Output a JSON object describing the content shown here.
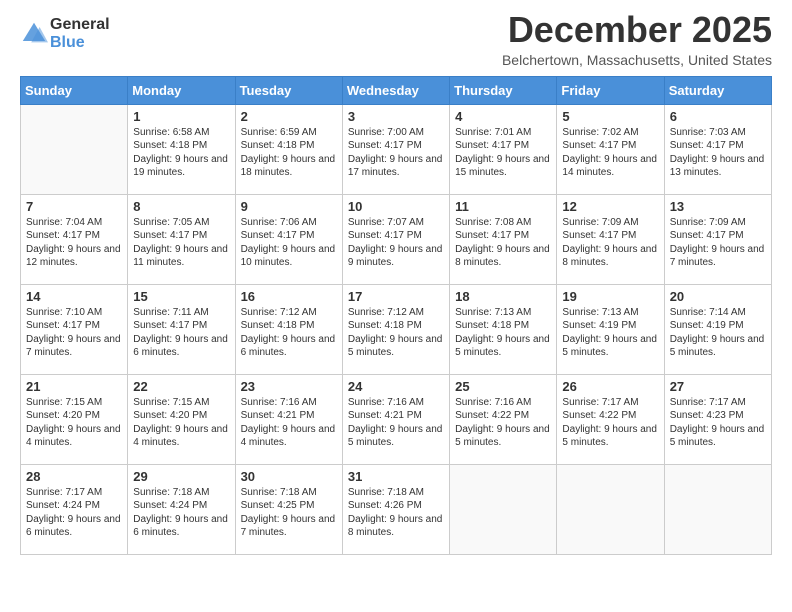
{
  "header": {
    "logo_line1": "General",
    "logo_line2": "Blue",
    "month_title": "December 2025",
    "location": "Belchertown, Massachusetts, United States"
  },
  "weekdays": [
    "Sunday",
    "Monday",
    "Tuesday",
    "Wednesday",
    "Thursday",
    "Friday",
    "Saturday"
  ],
  "weeks": [
    [
      {
        "day": "",
        "sunrise": "",
        "sunset": "",
        "daylight": ""
      },
      {
        "day": "1",
        "sunrise": "Sunrise: 6:58 AM",
        "sunset": "Sunset: 4:18 PM",
        "daylight": "Daylight: 9 hours and 19 minutes."
      },
      {
        "day": "2",
        "sunrise": "Sunrise: 6:59 AM",
        "sunset": "Sunset: 4:18 PM",
        "daylight": "Daylight: 9 hours and 18 minutes."
      },
      {
        "day": "3",
        "sunrise": "Sunrise: 7:00 AM",
        "sunset": "Sunset: 4:17 PM",
        "daylight": "Daylight: 9 hours and 17 minutes."
      },
      {
        "day": "4",
        "sunrise": "Sunrise: 7:01 AM",
        "sunset": "Sunset: 4:17 PM",
        "daylight": "Daylight: 9 hours and 15 minutes."
      },
      {
        "day": "5",
        "sunrise": "Sunrise: 7:02 AM",
        "sunset": "Sunset: 4:17 PM",
        "daylight": "Daylight: 9 hours and 14 minutes."
      },
      {
        "day": "6",
        "sunrise": "Sunrise: 7:03 AM",
        "sunset": "Sunset: 4:17 PM",
        "daylight": "Daylight: 9 hours and 13 minutes."
      }
    ],
    [
      {
        "day": "7",
        "sunrise": "Sunrise: 7:04 AM",
        "sunset": "Sunset: 4:17 PM",
        "daylight": "Daylight: 9 hours and 12 minutes."
      },
      {
        "day": "8",
        "sunrise": "Sunrise: 7:05 AM",
        "sunset": "Sunset: 4:17 PM",
        "daylight": "Daylight: 9 hours and 11 minutes."
      },
      {
        "day": "9",
        "sunrise": "Sunrise: 7:06 AM",
        "sunset": "Sunset: 4:17 PM",
        "daylight": "Daylight: 9 hours and 10 minutes."
      },
      {
        "day": "10",
        "sunrise": "Sunrise: 7:07 AM",
        "sunset": "Sunset: 4:17 PM",
        "daylight": "Daylight: 9 hours and 9 minutes."
      },
      {
        "day": "11",
        "sunrise": "Sunrise: 7:08 AM",
        "sunset": "Sunset: 4:17 PM",
        "daylight": "Daylight: 9 hours and 8 minutes."
      },
      {
        "day": "12",
        "sunrise": "Sunrise: 7:09 AM",
        "sunset": "Sunset: 4:17 PM",
        "daylight": "Daylight: 9 hours and 8 minutes."
      },
      {
        "day": "13",
        "sunrise": "Sunrise: 7:09 AM",
        "sunset": "Sunset: 4:17 PM",
        "daylight": "Daylight: 9 hours and 7 minutes."
      }
    ],
    [
      {
        "day": "14",
        "sunrise": "Sunrise: 7:10 AM",
        "sunset": "Sunset: 4:17 PM",
        "daylight": "Daylight: 9 hours and 7 minutes."
      },
      {
        "day": "15",
        "sunrise": "Sunrise: 7:11 AM",
        "sunset": "Sunset: 4:17 PM",
        "daylight": "Daylight: 9 hours and 6 minutes."
      },
      {
        "day": "16",
        "sunrise": "Sunrise: 7:12 AM",
        "sunset": "Sunset: 4:18 PM",
        "daylight": "Daylight: 9 hours and 6 minutes."
      },
      {
        "day": "17",
        "sunrise": "Sunrise: 7:12 AM",
        "sunset": "Sunset: 4:18 PM",
        "daylight": "Daylight: 9 hours and 5 minutes."
      },
      {
        "day": "18",
        "sunrise": "Sunrise: 7:13 AM",
        "sunset": "Sunset: 4:18 PM",
        "daylight": "Daylight: 9 hours and 5 minutes."
      },
      {
        "day": "19",
        "sunrise": "Sunrise: 7:13 AM",
        "sunset": "Sunset: 4:19 PM",
        "daylight": "Daylight: 9 hours and 5 minutes."
      },
      {
        "day": "20",
        "sunrise": "Sunrise: 7:14 AM",
        "sunset": "Sunset: 4:19 PM",
        "daylight": "Daylight: 9 hours and 5 minutes."
      }
    ],
    [
      {
        "day": "21",
        "sunrise": "Sunrise: 7:15 AM",
        "sunset": "Sunset: 4:20 PM",
        "daylight": "Daylight: 9 hours and 4 minutes."
      },
      {
        "day": "22",
        "sunrise": "Sunrise: 7:15 AM",
        "sunset": "Sunset: 4:20 PM",
        "daylight": "Daylight: 9 hours and 4 minutes."
      },
      {
        "day": "23",
        "sunrise": "Sunrise: 7:16 AM",
        "sunset": "Sunset: 4:21 PM",
        "daylight": "Daylight: 9 hours and 4 minutes."
      },
      {
        "day": "24",
        "sunrise": "Sunrise: 7:16 AM",
        "sunset": "Sunset: 4:21 PM",
        "daylight": "Daylight: 9 hours and 5 minutes."
      },
      {
        "day": "25",
        "sunrise": "Sunrise: 7:16 AM",
        "sunset": "Sunset: 4:22 PM",
        "daylight": "Daylight: 9 hours and 5 minutes."
      },
      {
        "day": "26",
        "sunrise": "Sunrise: 7:17 AM",
        "sunset": "Sunset: 4:22 PM",
        "daylight": "Daylight: 9 hours and 5 minutes."
      },
      {
        "day": "27",
        "sunrise": "Sunrise: 7:17 AM",
        "sunset": "Sunset: 4:23 PM",
        "daylight": "Daylight: 9 hours and 5 minutes."
      }
    ],
    [
      {
        "day": "28",
        "sunrise": "Sunrise: 7:17 AM",
        "sunset": "Sunset: 4:24 PM",
        "daylight": "Daylight: 9 hours and 6 minutes."
      },
      {
        "day": "29",
        "sunrise": "Sunrise: 7:18 AM",
        "sunset": "Sunset: 4:24 PM",
        "daylight": "Daylight: 9 hours and 6 minutes."
      },
      {
        "day": "30",
        "sunrise": "Sunrise: 7:18 AM",
        "sunset": "Sunset: 4:25 PM",
        "daylight": "Daylight: 9 hours and 7 minutes."
      },
      {
        "day": "31",
        "sunrise": "Sunrise: 7:18 AM",
        "sunset": "Sunset: 4:26 PM",
        "daylight": "Daylight: 9 hours and 8 minutes."
      },
      {
        "day": "",
        "sunrise": "",
        "sunset": "",
        "daylight": ""
      },
      {
        "day": "",
        "sunrise": "",
        "sunset": "",
        "daylight": ""
      },
      {
        "day": "",
        "sunrise": "",
        "sunset": "",
        "daylight": ""
      }
    ]
  ]
}
